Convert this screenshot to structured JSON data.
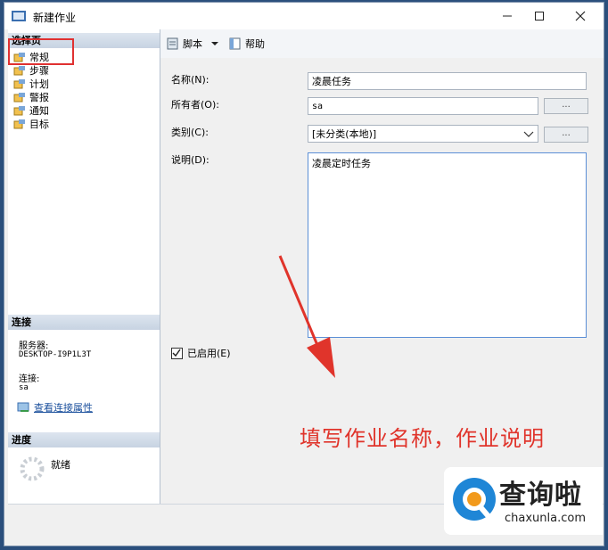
{
  "window": {
    "title": "新建作业"
  },
  "left": {
    "select_page_header": "选择页",
    "pages": [
      "常规",
      "步骤",
      "计划",
      "警报",
      "通知",
      "目标"
    ],
    "connection_header": "连接",
    "server_label": "服务器:",
    "server_value": "DESKTOP-I9P1L3T",
    "connection_label": "连接:",
    "connection_value": "sa",
    "view_connection_link": "查看连接属性",
    "progress_header": "进度",
    "progress_status": "就绪"
  },
  "toolbar": {
    "script_label": "脚本",
    "help_label": "帮助"
  },
  "form": {
    "name_label": "名称(N):",
    "name_value": "凌晨任务",
    "owner_label": "所有者(O):",
    "owner_value": "sa",
    "category_label": "类别(C):",
    "category_value": "[未分类(本地)]",
    "description_label": "说明(D):",
    "description_value": "凌晨定时任务",
    "browse_label": "...",
    "enabled_label": "已启用(E)"
  },
  "annotation": {
    "text": "填写作业名称，作业说明"
  },
  "watermark": {
    "brand": "查询啦",
    "url": "chaxunla.com"
  },
  "colors": {
    "annotation_red": "#e0342b",
    "highlight_red": "#e03131"
  }
}
